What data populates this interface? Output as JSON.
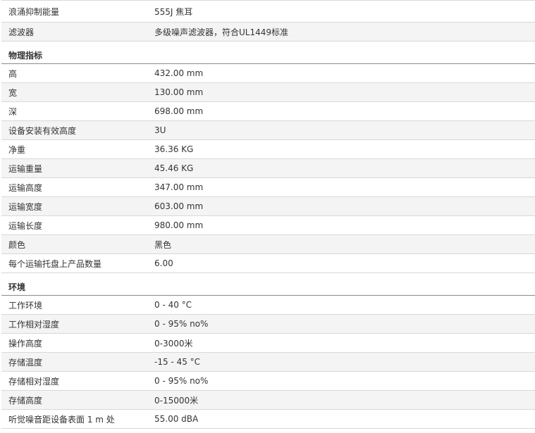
{
  "top_rows": [
    {
      "label": "浪涌抑制能量",
      "value": "555J 焦耳"
    },
    {
      "label": "滤波器",
      "value": "多级噪声滤波器，符合UL1449标准"
    }
  ],
  "sections": [
    {
      "title": "物理指标",
      "rows": [
        {
          "label": "高",
          "value": "432.00 mm"
        },
        {
          "label": "宽",
          "value": "130.00 mm"
        },
        {
          "label": "深",
          "value": "698.00 mm"
        },
        {
          "label": "设备安装有效高度",
          "value": "3U"
        },
        {
          "label": "净重",
          "value": "36.36 KG"
        },
        {
          "label": "运输重量",
          "value": "45.46 KG"
        },
        {
          "label": "运输高度",
          "value": "347.00 mm"
        },
        {
          "label": "运输宽度",
          "value": "603.00 mm"
        },
        {
          "label": "运输长度",
          "value": "980.00 mm"
        },
        {
          "label": "颜色",
          "value": "黑色"
        },
        {
          "label": "每个运输托盘上产品数量",
          "value": "6.00"
        }
      ]
    },
    {
      "title": "环境",
      "rows": [
        {
          "label": "工作环境",
          "value": "0 - 40 °C"
        },
        {
          "label": "工作相对湿度",
          "value": "0 - 95% no%"
        },
        {
          "label": "操作高度",
          "value": "0-3000米"
        },
        {
          "label": "存储温度",
          "value": "-15 - 45 °C"
        },
        {
          "label": "存储相对湿度",
          "value": "0 - 95% no%"
        },
        {
          "label": "存储高度",
          "value": "0-15000米"
        },
        {
          "label": "听觉噪音距设备表面 1 m 处",
          "value": "55.00 dBA"
        }
      ]
    }
  ]
}
